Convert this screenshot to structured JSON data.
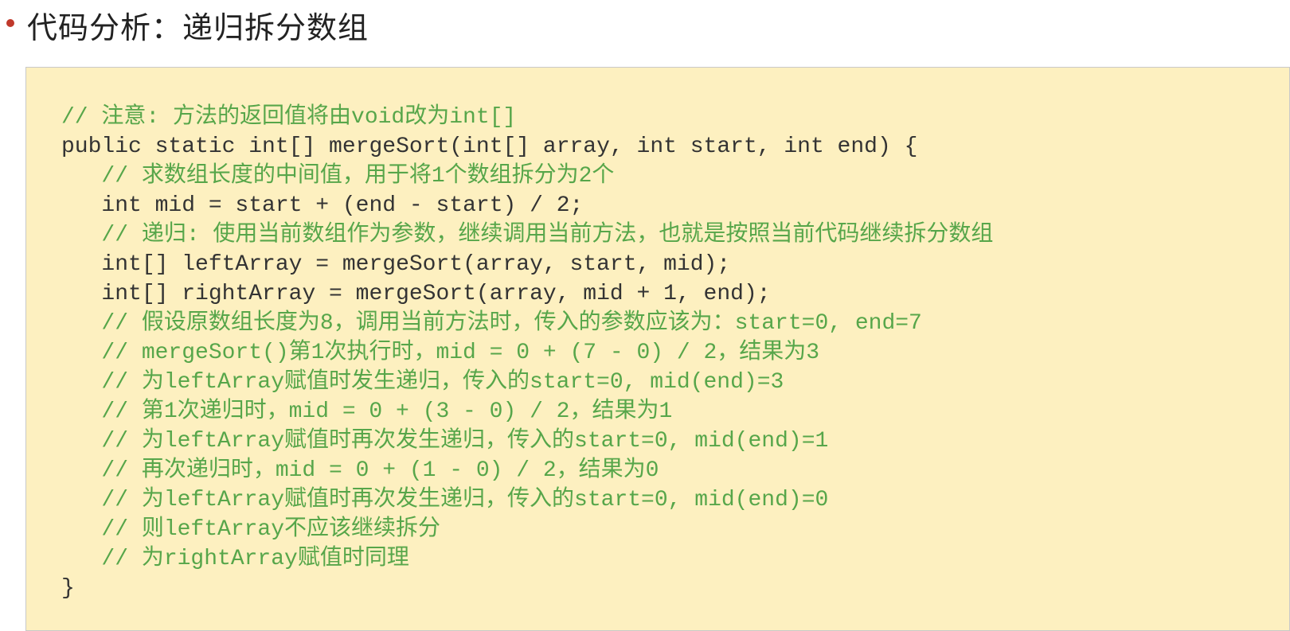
{
  "title": "代码分析：递归拆分数组",
  "code": {
    "lines": [
      {
        "indent": 1,
        "comment": true,
        "text": "// 注意: 方法的返回值将由void改为int[]"
      },
      {
        "indent": 1,
        "comment": false,
        "text": "public static int[] mergeSort(int[] array, int start, int end) {"
      },
      {
        "indent": 2,
        "comment": true,
        "text": "// 求数组长度的中间值，用于将1个数组拆分为2个"
      },
      {
        "indent": 2,
        "comment": false,
        "text": "int mid = start + (end - start) / 2;"
      },
      {
        "indent": 2,
        "comment": true,
        "text": "// 递归: 使用当前数组作为参数，继续调用当前方法，也就是按照当前代码继续拆分数组"
      },
      {
        "indent": 2,
        "comment": false,
        "text": "int[] leftArray = mergeSort(array, start, mid);"
      },
      {
        "indent": 2,
        "comment": false,
        "text": "int[] rightArray = mergeSort(array, mid + 1, end);"
      },
      {
        "indent": 2,
        "comment": true,
        "text": "// 假设原数组长度为8，调用当前方法时，传入的参数应该为：start=0, end=7"
      },
      {
        "indent": 2,
        "comment": true,
        "text": "// mergeSort()第1次执行时，mid = 0 + (7 - 0) / 2，结果为3"
      },
      {
        "indent": 2,
        "comment": true,
        "text": "// 为leftArray赋值时发生递归，传入的start=0, mid(end)=3"
      },
      {
        "indent": 2,
        "comment": true,
        "text": "// 第1次递归时，mid = 0 + (3 - 0) / 2，结果为1"
      },
      {
        "indent": 2,
        "comment": true,
        "text": "// 为leftArray赋值时再次发生递归，传入的start=0, mid(end)=1"
      },
      {
        "indent": 2,
        "comment": true,
        "text": "// 再次递归时，mid = 0 + (1 - 0) / 2，结果为0"
      },
      {
        "indent": 2,
        "comment": true,
        "text": "// 为leftArray赋值时再次发生递归，传入的start=0, mid(end)=0"
      },
      {
        "indent": 2,
        "comment": true,
        "text": "// 则leftArray不应该继续拆分"
      },
      {
        "indent": 2,
        "comment": true,
        "text": "// 为rightArray赋值时同理"
      },
      {
        "indent": 1,
        "comment": false,
        "text": "}"
      }
    ]
  }
}
